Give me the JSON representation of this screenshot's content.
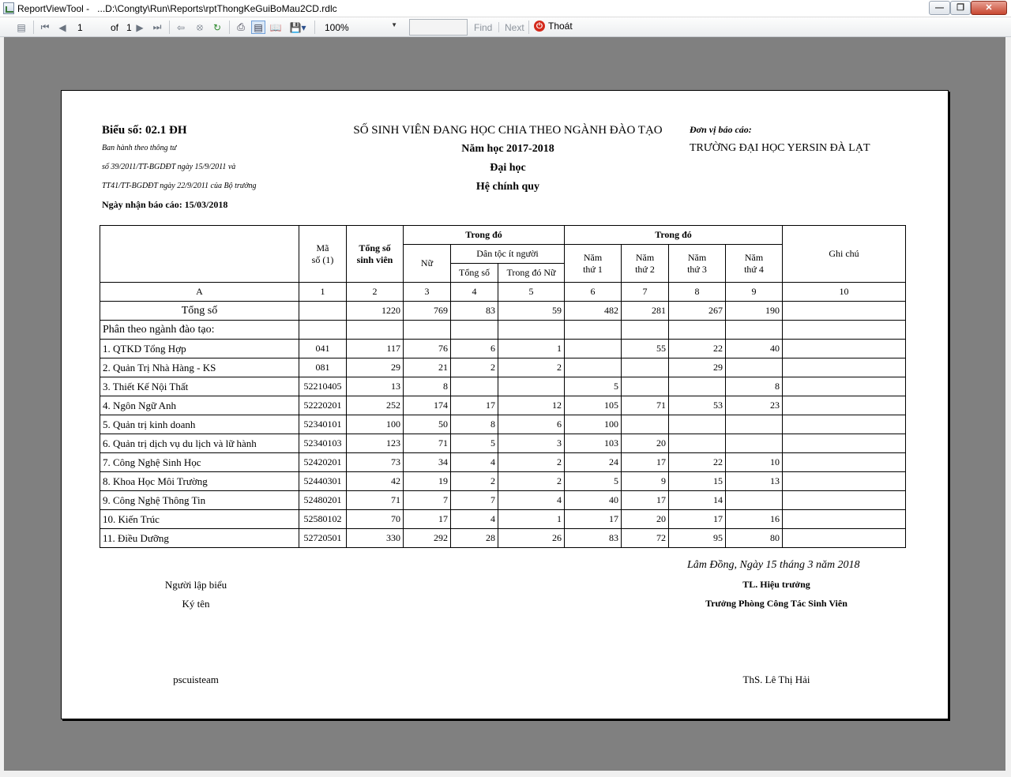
{
  "window": {
    "title": "ReportViewTool -   ...D:\\Congty\\Run\\Reports\\rptThongKeGuiBoMau2CD.rdlc"
  },
  "toolbar": {
    "page_current": "1",
    "page_of": "of",
    "page_total": "1",
    "zoom": "100%",
    "find_label": "Find",
    "next_label": "Next",
    "exit_label": "Thoát"
  },
  "report": {
    "form_code": "Biểu số: 02.1 ĐH",
    "issued_lines": [
      "Ban hành theo thông tư",
      "số 39/2011/TT-BGDĐT ngày 15/9/2011 và",
      "TT41/TT-BGDĐT ngày 22/9/2011 của Bộ trưởng"
    ],
    "received_date": "Ngày nhận báo cáo: 15/03/2018",
    "title_lines": [
      "SỐ SINH VIÊN ĐANG HỌC CHIA THEO NGÀNH ĐÀO TẠO",
      "Năm học 2017-2018",
      "Đại học",
      "Hệ chính quy"
    ],
    "unit_label": "Đơn vị báo cáo:",
    "unit_name": "TRƯỜNG ĐẠI HỌC YERSIN ĐÀ LẠT"
  },
  "table": {
    "headers": {
      "code": "Mã\nsố (1)",
      "total": "Tổng số\nsinh viên",
      "group1": "Trong đó",
      "female": "Nữ",
      "ethnic": "Dân tộc ít người",
      "ethnic_total": "Tổng số",
      "ethnic_female": "Trong đó Nữ",
      "group2": "Trong đó",
      "year1": "Năm\nthứ 1",
      "year2": "Năm\nthứ 2",
      "year3": "Năm\nthứ 3",
      "year4": "Năm\nthứ 4",
      "note": "Ghi chú"
    },
    "col_index": [
      "A",
      "1",
      "2",
      "3",
      "4",
      "5",
      "6",
      "7",
      "8",
      "9",
      "10"
    ],
    "total_row": {
      "label": "Tổng số",
      "values": [
        "",
        "1220",
        "769",
        "83",
        "59",
        "482",
        "281",
        "267",
        "190",
        ""
      ]
    },
    "section_label": "Phân theo ngành đào tạo:",
    "rows": [
      {
        "name": "1. QTKD Tổng Hợp",
        "code": "041",
        "values": [
          "117",
          "76",
          "6",
          "1",
          "",
          "55",
          "22",
          "40",
          ""
        ]
      },
      {
        "name": "2. Quản Trị Nhà Hàng - KS",
        "code": "081",
        "values": [
          "29",
          "21",
          "2",
          "2",
          "",
          "",
          "29",
          "",
          ""
        ]
      },
      {
        "name": "3. Thiết Kế Nội Thất",
        "code": "52210405",
        "values": [
          "13",
          "8",
          "",
          "",
          "5",
          "",
          "",
          "8",
          ""
        ]
      },
      {
        "name": "4. Ngôn Ngữ Anh",
        "code": "52220201",
        "values": [
          "252",
          "174",
          "17",
          "12",
          "105",
          "71",
          "53",
          "23",
          ""
        ]
      },
      {
        "name": "5. Quản trị kinh doanh",
        "code": "52340101",
        "values": [
          "100",
          "50",
          "8",
          "6",
          "100",
          "",
          "",
          "",
          ""
        ]
      },
      {
        "name": "6. Quản trị dịch vụ du lịch và lữ hành",
        "code": "52340103",
        "values": [
          "123",
          "71",
          "5",
          "3",
          "103",
          "20",
          "",
          "",
          ""
        ]
      },
      {
        "name": "7. Công Nghệ Sinh Học",
        "code": "52420201",
        "values": [
          "73",
          "34",
          "4",
          "2",
          "24",
          "17",
          "22",
          "10",
          ""
        ]
      },
      {
        "name": "8. Khoa Học Môi Trường",
        "code": "52440301",
        "values": [
          "42",
          "19",
          "2",
          "2",
          "5",
          "9",
          "15",
          "13",
          ""
        ]
      },
      {
        "name": "9. Công Nghệ Thông Tin",
        "code": "52480201",
        "values": [
          "71",
          "7",
          "7",
          "4",
          "40",
          "17",
          "14",
          "",
          ""
        ]
      },
      {
        "name": "10. Kiến Trúc",
        "code": "52580102",
        "values": [
          "70",
          "17",
          "4",
          "1",
          "17",
          "20",
          "17",
          "16",
          ""
        ]
      },
      {
        "name": "11. Điều Dưỡng",
        "code": "52720501",
        "values": [
          "330",
          "292",
          "28",
          "26",
          "83",
          "72",
          "95",
          "80",
          ""
        ]
      }
    ]
  },
  "footer": {
    "place_date": "Lâm Đồng, Ngày 15 tháng 3 năm 2018",
    "left_title": "Người lập biểu",
    "left_sign": "Ký tên",
    "left_name": "pscuisteam",
    "right_title": "TL. Hiệu trưởng",
    "right_sub": "Trưởng Phòng Công Tác Sinh Viên",
    "right_name": "ThS. Lê Thị Hải"
  }
}
